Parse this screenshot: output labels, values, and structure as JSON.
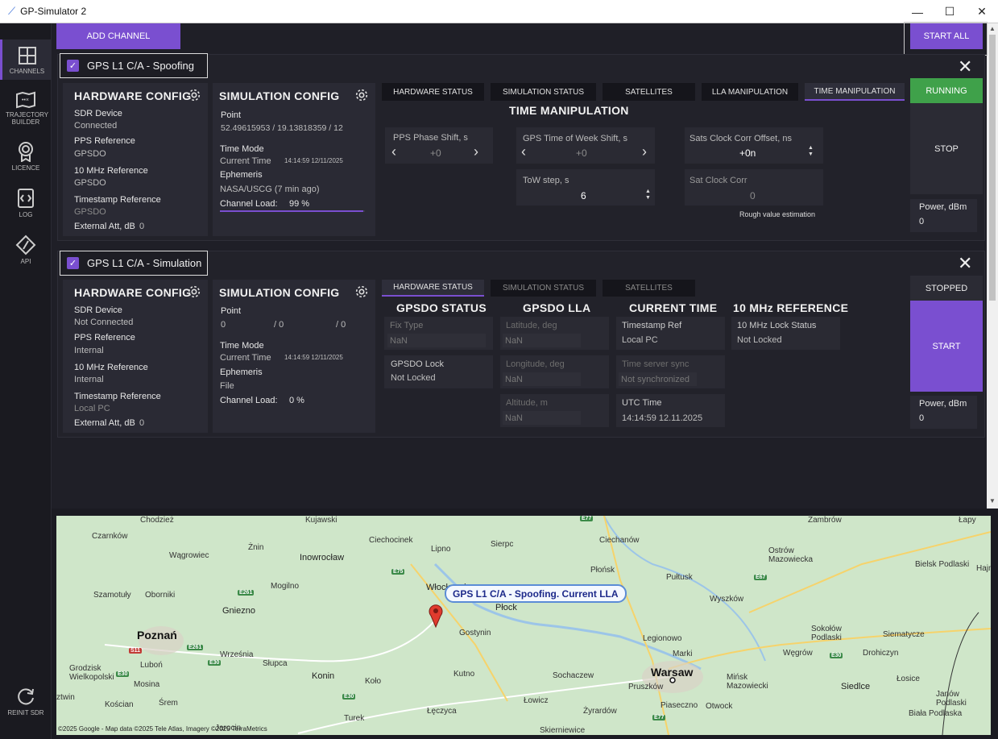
{
  "window": {
    "title": "GP-Simulator 2",
    "min": "—",
    "max": "☐",
    "close": "✕"
  },
  "sidebar": [
    {
      "label": "CHANNELS",
      "icon": "channels-icon"
    },
    {
      "label": "TRAJECTORY BUILDER",
      "icon": "trajectory-icon"
    },
    {
      "label": "LICENCE",
      "icon": "licence-icon"
    },
    {
      "label": "LOG",
      "icon": "log-icon"
    },
    {
      "label": "API",
      "icon": "api-icon"
    },
    {
      "label": "REINIT SDR",
      "icon": "reinit-icon"
    }
  ],
  "toolbar": {
    "add_channel": "ADD CHANNEL",
    "start_all": "START ALL"
  },
  "channel1": {
    "name": "GPS L1 C/A - Spoofing",
    "checked": true,
    "hardware": {
      "title": "HARDWARE CONFIG",
      "sdr_label": "SDR Device",
      "sdr_value": "Connected",
      "pps_label": "PPS Reference",
      "pps_value": "GPSDO",
      "mhz_label": "10 MHz Reference",
      "mhz_value": "GPSDO",
      "ts_label": "Timestamp Reference",
      "ts_value": "GPSDO",
      "att_label": "External Att, dB",
      "att_value": "0"
    },
    "sim": {
      "title": "SIMULATION CONFIG",
      "point_label": "Point",
      "point_value": "52.49615953 / 19.13818359  / 12",
      "mode_label": "Time Mode",
      "mode_value": "Current Time",
      "mode_time": "14:14:59 12/11/2025",
      "eph_label": "Ephemeris",
      "eph_value": "NASA/USCG (7 min ago)",
      "load_label": "Channel Load:",
      "load_value": "99 %",
      "load_fraction": 0.99
    },
    "tabs": [
      "HARDWARE STATUS",
      "SIMULATION STATUS",
      "SATELLITES",
      "LLA MANIPULATION",
      "TIME MANIPULATION"
    ],
    "time_manip": {
      "title": "TIME MANIPULATION",
      "pps_label": "PPS Phase Shift, s",
      "pps_value": "+0",
      "tow_label": "GPS Time of Week Shift, s",
      "tow_value": "+0",
      "towstep_label": "ToW step, s",
      "towstep_value": "6",
      "clkoff_label": "Sats Clock Corr Offset, ns",
      "clkoff_value": "+0n",
      "clkcorr_label": "Sat Clock Corr",
      "clkcorr_value": "0",
      "note": "Rough value estimation"
    },
    "status": "RUNNING",
    "action": "STOP",
    "power_label": "Power, dBm",
    "power_value": "0"
  },
  "channel2": {
    "name": "GPS L1 C/A - Simulation",
    "checked": true,
    "hardware": {
      "title": "HARDWARE CONFIG",
      "sdr_label": "SDR Device",
      "sdr_value": "Not Connected",
      "pps_label": "PPS Reference",
      "pps_value": "Internal",
      "mhz_label": "10 MHz Reference",
      "mhz_value": "Internal",
      "ts_label": "Timestamp Reference",
      "ts_value": "Local PC",
      "att_label": "External Att, dB",
      "att_value": "0"
    },
    "sim": {
      "title": "SIMULATION CONFIG",
      "point_label": "Point",
      "p1": "0",
      "p2": "/ 0",
      "p3": "/ 0",
      "mode_label": "Time Mode",
      "mode_value": "Current Time",
      "mode_time": "14:14:59 12/11/2025",
      "eph_label": "Ephemeris",
      "eph_value": "File",
      "load_label": "Channel Load:",
      "load_value": "0 %"
    },
    "tabs": [
      "HARDWARE STATUS",
      "SIMULATION STATUS",
      "SATELLITES"
    ],
    "gpsdo_status": {
      "title": "GPSDO STATUS",
      "fix_label": "Fix Type",
      "fix_value": "NaN",
      "lock_label": "GPSDO Lock",
      "lock_value": "Not Locked"
    },
    "gpsdo_lla": {
      "title": "GPSDO LLA",
      "lat_label": "Latitude, deg",
      "lat_value": "NaN",
      "lon_label": "Longitude, deg",
      "lon_value": "NaN",
      "alt_label": "Altitude, m",
      "alt_value": "NaN"
    },
    "current_time": {
      "title": "CURRENT TIME",
      "tsref_label": "Timestamp Ref",
      "tsref_value": "Local PC",
      "sync_label": "Time server sync",
      "sync_value": "Not synchronized",
      "utc_label": "UTC Time",
      "utc_value": "14:14:59 12.11.2025"
    },
    "mhz_ref": {
      "title": "10 MHz REFERENCE",
      "lock_label": "10 MHz Lock Status",
      "lock_value": "Not Locked"
    },
    "status": "STOPPED",
    "action": "START",
    "power_label": "Power, dBm",
    "power_value": "0"
  },
  "map": {
    "callout": "GPS L1 C/A - Spoofing. Current LLA",
    "attribution": "©2025 Google - Map data ©2025 Tele Atlas, Imagery ©2025 TerraMetrics",
    "places": [
      "Chodzież",
      "Kujawski",
      "Zambrów",
      "Łapy",
      "Czarnków",
      "Ciechocinek",
      "Ciechanów",
      "Wągrowiec",
      "Żnin",
      "Inowrocław",
      "Lipno",
      "Sierpc",
      "Ostrów Mazowiecka",
      "Bielsk Podlaski",
      "Hajn",
      "Szamotuły",
      "Oborniki",
      "Mogilno",
      "Włocławek",
      "Płońsk",
      "Pułtusk",
      "Wyszków",
      "Gniezno",
      "Płock",
      "Poznań",
      "Września",
      "Słupca",
      "Gostynin",
      "Legionowo",
      "Sokołów Podlaski",
      "Siematycze",
      "Grodzisk Wielkopolski",
      "Luboń",
      "Konin",
      "Kutno",
      "Marki",
      "Węgrów",
      "Drohiczyn",
      "Mosina",
      "Koło",
      "Sochaczew",
      "Warsaw",
      "Mińsk Mazowiecki",
      "Siedlce",
      "Łosice",
      "Kościan",
      "Śrem",
      "Pruszków",
      "Janów Podlaski",
      "Łowicz",
      "Żyrardów",
      "Piaseczno",
      "Otwock",
      "Turek",
      "Łęczyca",
      "Biała Podlaska",
      "Skierniewice",
      "Jarocin",
      "ztwin"
    ],
    "roads": [
      "E77",
      "E75",
      "E261",
      "S11",
      "E67",
      "E30",
      "E261",
      "E30",
      "E30",
      "E77",
      "E30"
    ]
  }
}
